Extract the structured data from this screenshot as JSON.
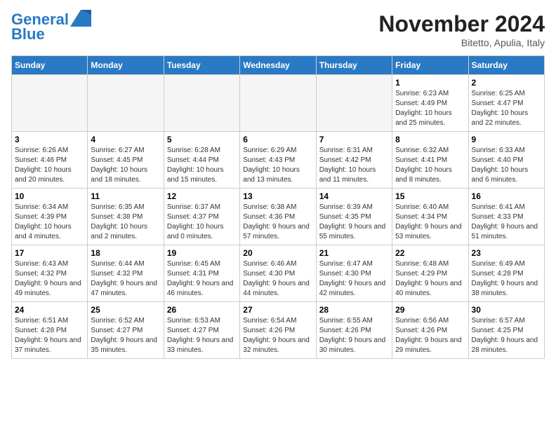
{
  "header": {
    "logo_line1": "General",
    "logo_line2": "Blue",
    "month_title": "November 2024",
    "location": "Bitetto, Apulia, Italy"
  },
  "weekdays": [
    "Sunday",
    "Monday",
    "Tuesday",
    "Wednesday",
    "Thursday",
    "Friday",
    "Saturday"
  ],
  "weeks": [
    [
      {
        "day": "",
        "info": ""
      },
      {
        "day": "",
        "info": ""
      },
      {
        "day": "",
        "info": ""
      },
      {
        "day": "",
        "info": ""
      },
      {
        "day": "",
        "info": ""
      },
      {
        "day": "1",
        "info": "Sunrise: 6:23 AM\nSunset: 4:49 PM\nDaylight: 10 hours and 25 minutes."
      },
      {
        "day": "2",
        "info": "Sunrise: 6:25 AM\nSunset: 4:47 PM\nDaylight: 10 hours and 22 minutes."
      }
    ],
    [
      {
        "day": "3",
        "info": "Sunrise: 6:26 AM\nSunset: 4:46 PM\nDaylight: 10 hours and 20 minutes."
      },
      {
        "day": "4",
        "info": "Sunrise: 6:27 AM\nSunset: 4:45 PM\nDaylight: 10 hours and 18 minutes."
      },
      {
        "day": "5",
        "info": "Sunrise: 6:28 AM\nSunset: 4:44 PM\nDaylight: 10 hours and 15 minutes."
      },
      {
        "day": "6",
        "info": "Sunrise: 6:29 AM\nSunset: 4:43 PM\nDaylight: 10 hours and 13 minutes."
      },
      {
        "day": "7",
        "info": "Sunrise: 6:31 AM\nSunset: 4:42 PM\nDaylight: 10 hours and 11 minutes."
      },
      {
        "day": "8",
        "info": "Sunrise: 6:32 AM\nSunset: 4:41 PM\nDaylight: 10 hours and 8 minutes."
      },
      {
        "day": "9",
        "info": "Sunrise: 6:33 AM\nSunset: 4:40 PM\nDaylight: 10 hours and 6 minutes."
      }
    ],
    [
      {
        "day": "10",
        "info": "Sunrise: 6:34 AM\nSunset: 4:39 PM\nDaylight: 10 hours and 4 minutes."
      },
      {
        "day": "11",
        "info": "Sunrise: 6:35 AM\nSunset: 4:38 PM\nDaylight: 10 hours and 2 minutes."
      },
      {
        "day": "12",
        "info": "Sunrise: 6:37 AM\nSunset: 4:37 PM\nDaylight: 10 hours and 0 minutes."
      },
      {
        "day": "13",
        "info": "Sunrise: 6:38 AM\nSunset: 4:36 PM\nDaylight: 9 hours and 57 minutes."
      },
      {
        "day": "14",
        "info": "Sunrise: 6:39 AM\nSunset: 4:35 PM\nDaylight: 9 hours and 55 minutes."
      },
      {
        "day": "15",
        "info": "Sunrise: 6:40 AM\nSunset: 4:34 PM\nDaylight: 9 hours and 53 minutes."
      },
      {
        "day": "16",
        "info": "Sunrise: 6:41 AM\nSunset: 4:33 PM\nDaylight: 9 hours and 51 minutes."
      }
    ],
    [
      {
        "day": "17",
        "info": "Sunrise: 6:43 AM\nSunset: 4:32 PM\nDaylight: 9 hours and 49 minutes."
      },
      {
        "day": "18",
        "info": "Sunrise: 6:44 AM\nSunset: 4:32 PM\nDaylight: 9 hours and 47 minutes."
      },
      {
        "day": "19",
        "info": "Sunrise: 6:45 AM\nSunset: 4:31 PM\nDaylight: 9 hours and 46 minutes."
      },
      {
        "day": "20",
        "info": "Sunrise: 6:46 AM\nSunset: 4:30 PM\nDaylight: 9 hours and 44 minutes."
      },
      {
        "day": "21",
        "info": "Sunrise: 6:47 AM\nSunset: 4:30 PM\nDaylight: 9 hours and 42 minutes."
      },
      {
        "day": "22",
        "info": "Sunrise: 6:48 AM\nSunset: 4:29 PM\nDaylight: 9 hours and 40 minutes."
      },
      {
        "day": "23",
        "info": "Sunrise: 6:49 AM\nSunset: 4:28 PM\nDaylight: 9 hours and 38 minutes."
      }
    ],
    [
      {
        "day": "24",
        "info": "Sunrise: 6:51 AM\nSunset: 4:28 PM\nDaylight: 9 hours and 37 minutes."
      },
      {
        "day": "25",
        "info": "Sunrise: 6:52 AM\nSunset: 4:27 PM\nDaylight: 9 hours and 35 minutes."
      },
      {
        "day": "26",
        "info": "Sunrise: 6:53 AM\nSunset: 4:27 PM\nDaylight: 9 hours and 33 minutes."
      },
      {
        "day": "27",
        "info": "Sunrise: 6:54 AM\nSunset: 4:26 PM\nDaylight: 9 hours and 32 minutes."
      },
      {
        "day": "28",
        "info": "Sunrise: 6:55 AM\nSunset: 4:26 PM\nDaylight: 9 hours and 30 minutes."
      },
      {
        "day": "29",
        "info": "Sunrise: 6:56 AM\nSunset: 4:26 PM\nDaylight: 9 hours and 29 minutes."
      },
      {
        "day": "30",
        "info": "Sunrise: 6:57 AM\nSunset: 4:25 PM\nDaylight: 9 hours and 28 minutes."
      }
    ]
  ]
}
